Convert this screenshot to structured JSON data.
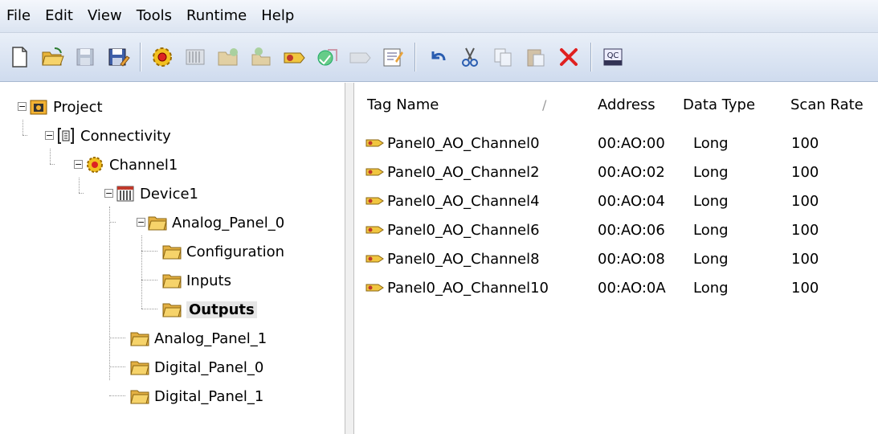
{
  "menu": [
    "File",
    "Edit",
    "View",
    "Tools",
    "Runtime",
    "Help"
  ],
  "toolbar": {
    "buttons": [
      "new-icon",
      "open-icon",
      "save-icon",
      "save-as-icon",
      "channel-icon",
      "device-icon",
      "add-group-icon",
      "add-tag-icon",
      "tag-wizard-icon",
      "duplicate-icon",
      "properties-icon",
      "undo-icon",
      "cut-icon",
      "copy-icon",
      "paste-icon",
      "delete-icon",
      "quick-client-icon"
    ],
    "qc_label": "QC"
  },
  "tree": {
    "project": "Project",
    "connectivity": "Connectivity",
    "channel": "Channel1",
    "device": "Device1",
    "groups": [
      "Analog_Panel_0",
      "Configuration",
      "Inputs",
      "Outputs",
      "Analog_Panel_1",
      "Digital_Panel_0",
      "Digital_Panel_1"
    ],
    "selected": "Outputs"
  },
  "table": {
    "columns": [
      "Tag Name",
      "Address",
      "Data Type",
      "Scan Rate"
    ],
    "rows": [
      {
        "name": "Panel0_AO_Channel0",
        "address": "00:AO:00",
        "type": "Long",
        "rate": "100"
      },
      {
        "name": "Panel0_AO_Channel2",
        "address": "00:AO:02",
        "type": "Long",
        "rate": "100"
      },
      {
        "name": "Panel0_AO_Channel4",
        "address": "00:AO:04",
        "type": "Long",
        "rate": "100"
      },
      {
        "name": "Panel0_AO_Channel6",
        "address": "00:AO:06",
        "type": "Long",
        "rate": "100"
      },
      {
        "name": "Panel0_AO_Channel8",
        "address": "00:AO:08",
        "type": "Long",
        "rate": "100"
      },
      {
        "name": "Panel0_AO_Channel10",
        "address": "00:AO:0A",
        "type": "Long",
        "rate": "100"
      }
    ]
  },
  "colors": {
    "folder": "#f2c24a",
    "delete": "#e02020",
    "selected_bg": "#e6e6e6"
  }
}
